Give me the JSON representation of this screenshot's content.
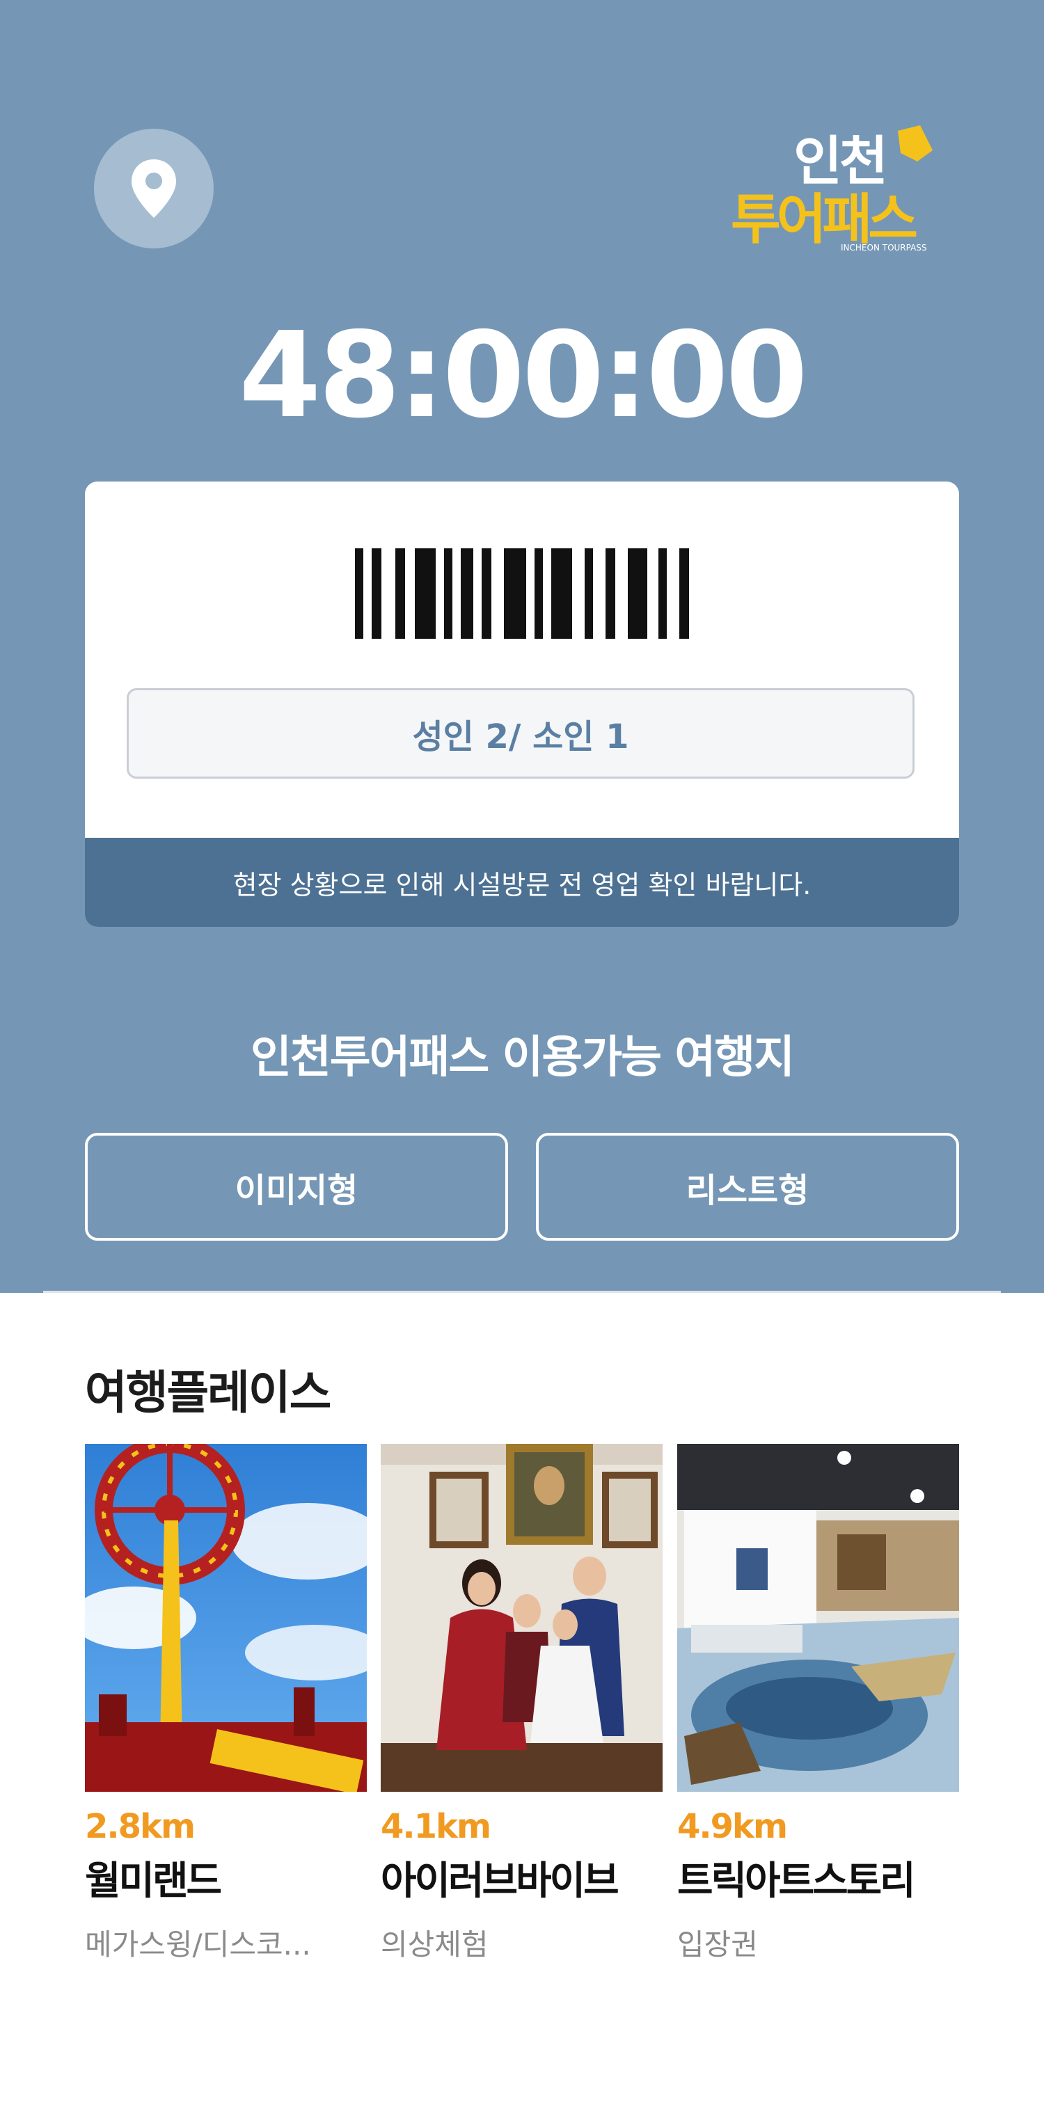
{
  "header": {
    "logo": {
      "line1": "인천",
      "line2": "투어패스",
      "sub": "INCHEON TOURPASS"
    },
    "timer": "48:00:00"
  },
  "ticket": {
    "passengers": "성인 2/ 소인 1",
    "notice": "현장 상황으로 인해 시설방문 전 영업 확인 바랍니다."
  },
  "available": {
    "title": "인천투어패스 이용가능 여행지",
    "image_view": "이미지형",
    "list_view": "리스트형"
  },
  "places": {
    "title": "여행플레이스",
    "items": [
      {
        "distance": "2.8km",
        "name": "월미랜드",
        "category": "메가스윙/디스코..."
      },
      {
        "distance": "4.1km",
        "name": "아이러브바이브",
        "category": "의상체험"
      },
      {
        "distance": "4.9km",
        "name": "트릭아트스토리",
        "category": "입장권"
      }
    ]
  },
  "colors": {
    "header_bg": "#7597b5",
    "notice_bg": "#4d7193",
    "distance": "#f19a21",
    "logo_yellow": "#f4c21b"
  }
}
